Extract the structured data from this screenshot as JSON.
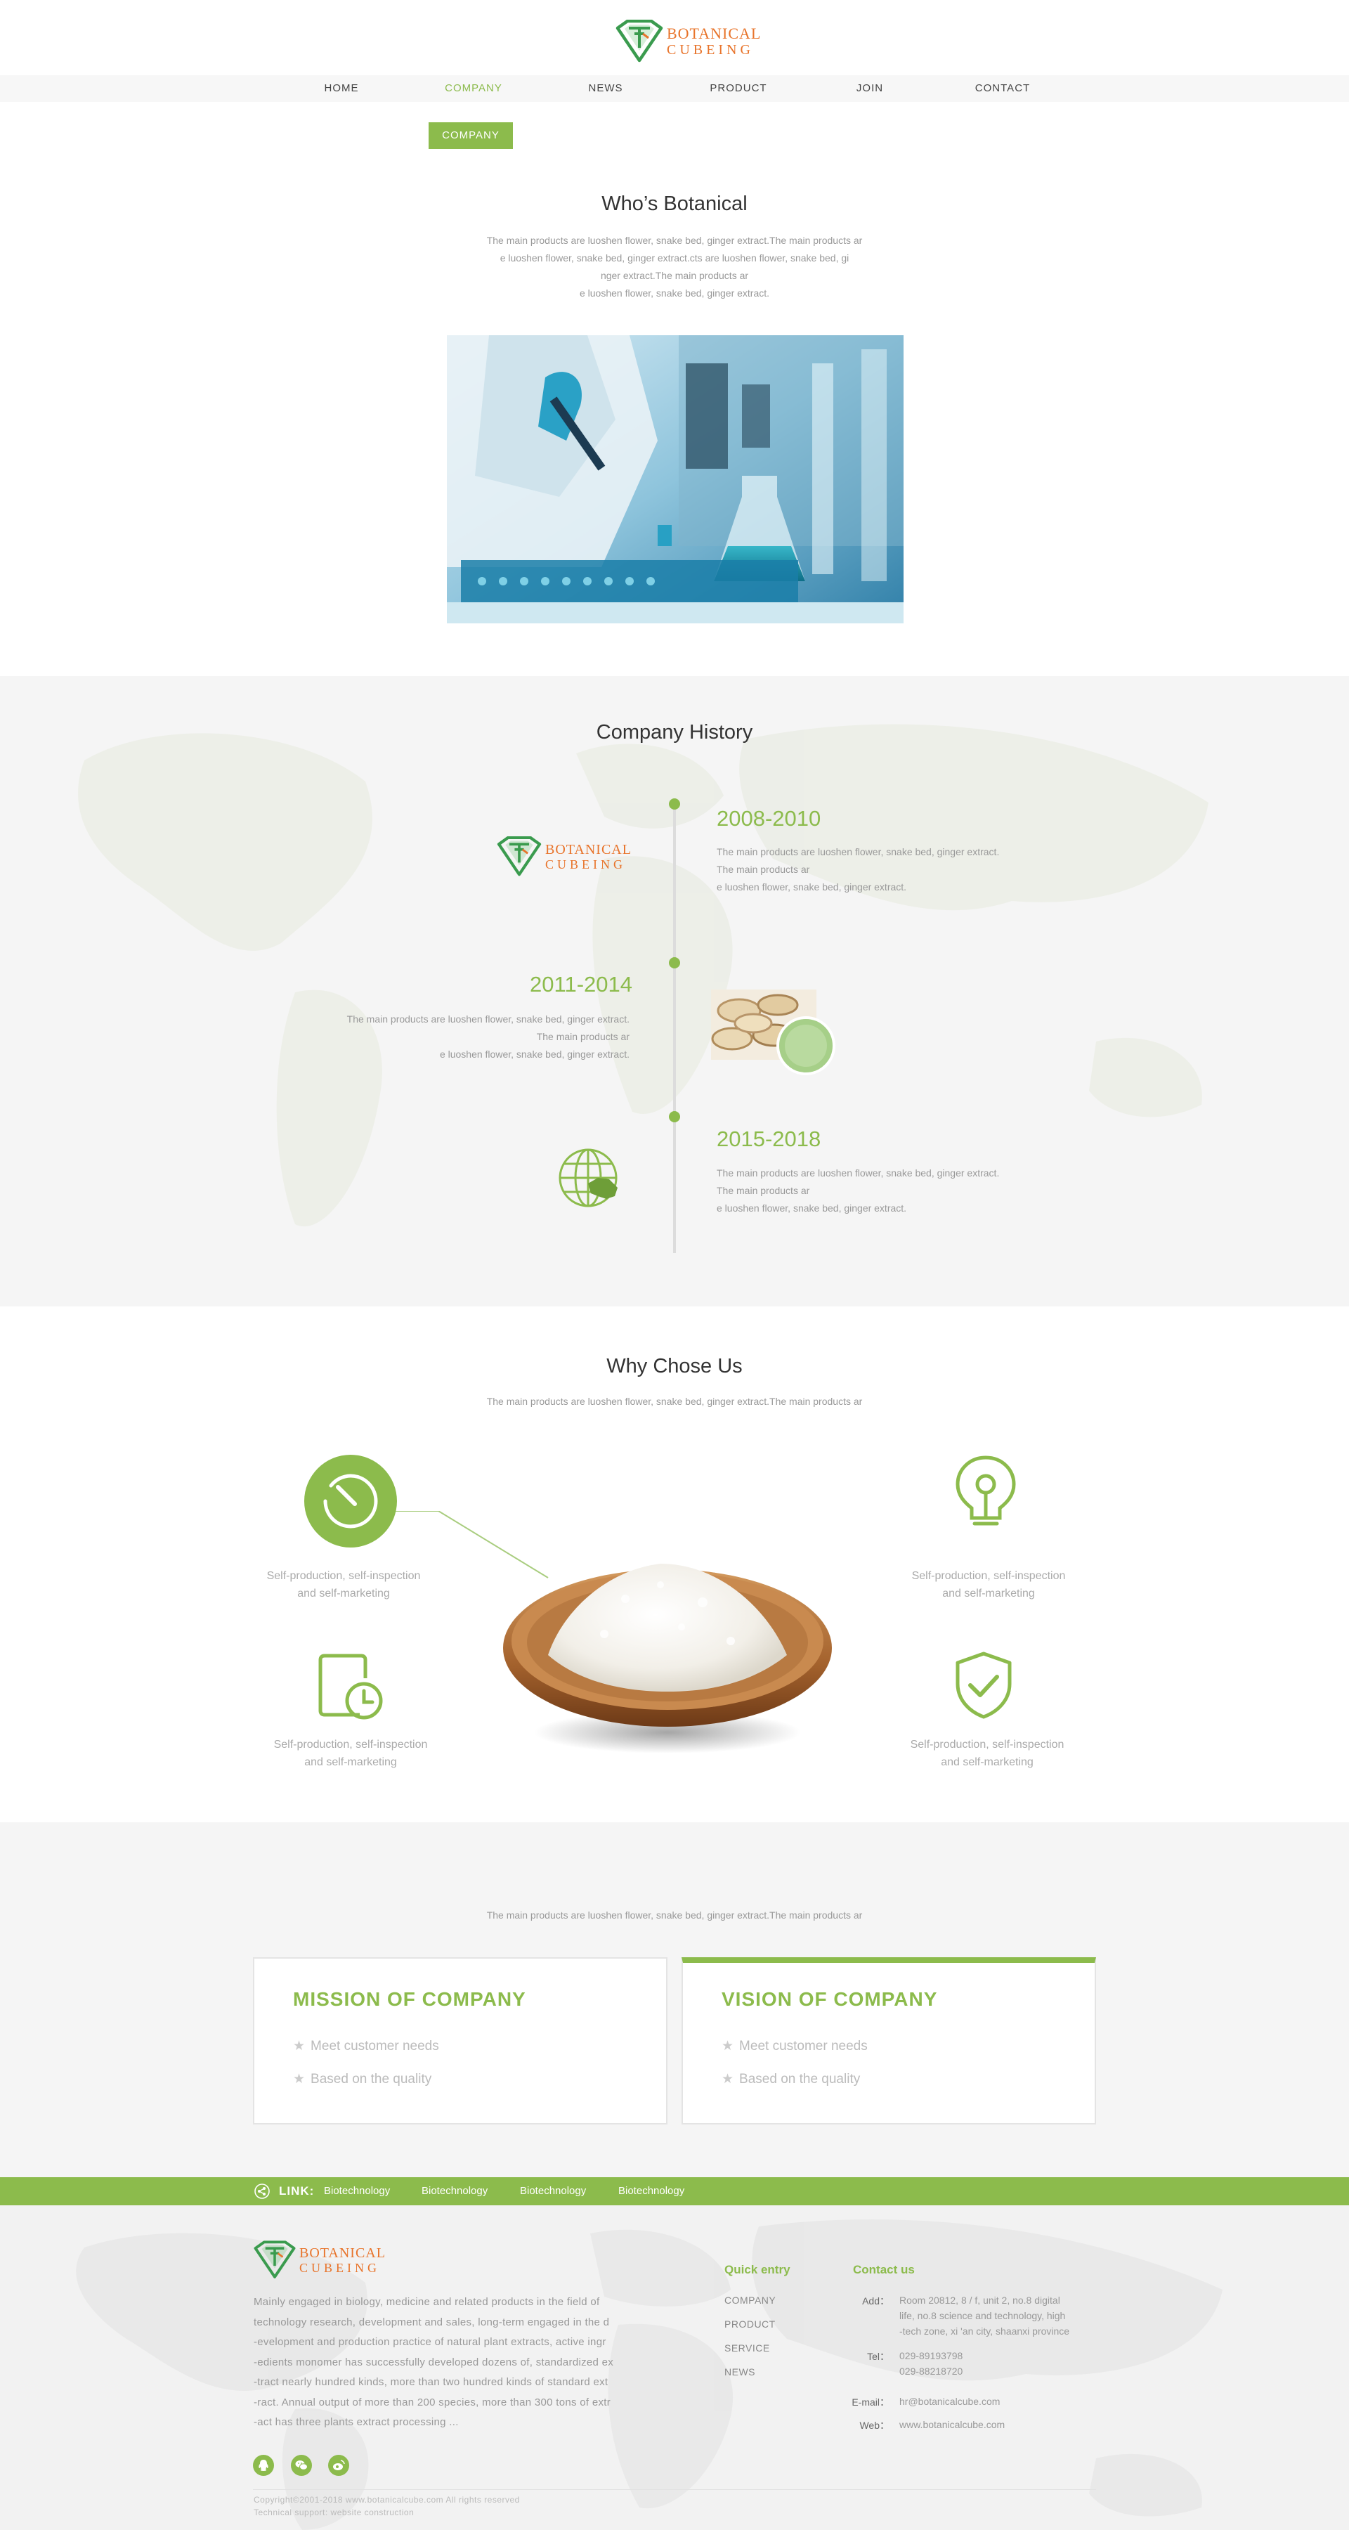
{
  "brand": {
    "line1": "BOTANICAL",
    "line2": "CUBEING"
  },
  "nav": [
    "HOME",
    "COMPANY",
    "NEWS",
    "PRODUCT",
    "JOIN",
    "CONTACT"
  ],
  "nav_active": "COMPANY",
  "breadcrumb": "COMPANY",
  "who": {
    "title": "Who’s Botanical",
    "lines": [
      "The main products are luoshen flower, snake bed, ginger extract.The main products ar",
      "e luoshen flower, snake bed, ginger extract.cts are luoshen flower, snake bed, gi",
      "nger extract.The main products ar",
      "e luoshen flower, snake bed, ginger extract."
    ]
  },
  "history": {
    "title": "Company History",
    "items": [
      {
        "year": "2008-2010",
        "lines": [
          "The main products are luoshen flower, snake bed, ginger extract.",
          "The main products ar",
          "e luoshen flower, snake bed, ginger extract."
        ]
      },
      {
        "year": "2011-2014",
        "lines": [
          "The main products are luoshen flower, snake bed, ginger extract.",
          "The main products ar",
          "e luoshen flower, snake bed, ginger extract."
        ]
      },
      {
        "year": "2015-2018",
        "lines": [
          "The main products are luoshen flower, snake bed, ginger extract.",
          "The main products ar",
          "e luoshen flower, snake bed, ginger extract."
        ]
      }
    ]
  },
  "why": {
    "title": "Why Chose Us",
    "subtitle": "The main products are luoshen flower, snake bed, ginger extract.The main products ar",
    "items": [
      {
        "icon": "dial-icon",
        "line1": "Self-production, self-inspection",
        "line2": "and self-marketing"
      },
      {
        "icon": "lightbulb-icon",
        "line1": "Self-production, self-inspection",
        "line2": "and self-marketing"
      },
      {
        "icon": "document-clock-icon",
        "line1": "Self-production, self-inspection",
        "line2": "and self-marketing"
      },
      {
        "icon": "shield-check-icon",
        "line1": "Self-production, self-inspection",
        "line2": "and self-marketing"
      }
    ]
  },
  "mission": {
    "subtitle": "The main products are luoshen flower, snake bed, ginger extract.The main products ar",
    "cards": [
      {
        "title": "MISSION OF COMPANY",
        "points": [
          "Meet customer needs",
          "Based on the quality"
        ]
      },
      {
        "title": "VISION OF COMPANY",
        "points": [
          "Meet customer needs",
          "Based on the quality"
        ]
      }
    ]
  },
  "links": {
    "label": "LINK:",
    "items": [
      "Biotechnology",
      "Biotechnology",
      "Biotechnology",
      "Biotechnology"
    ]
  },
  "footer": {
    "about": [
      "Mainly engaged in biology, medicine and related products in the field of",
      "technology research, development and sales, long-term engaged in the d",
      "-evelopment and production practice of natural plant extracts, active ingr",
      "-edients monomer has successfully developed dozens of, standardized ex",
      "-tract nearly hundred kinds, more than two hundred kinds of standard ext",
      "-ract. Annual output of more than 200 species, more than 300 tons of extr",
      "-act has three plants extract processing  ..."
    ],
    "quick_title": "Quick entry",
    "quick": [
      "COMPANY",
      "PRODUCT",
      "SERVICE",
      "NEWS"
    ],
    "contact_title": "Contact us",
    "contact": {
      "add_label": "Add：",
      "add": [
        "Room 20812, 8 / f, unit 2, no.8 digital",
        "life, no.8 science and technology, high",
        "-tech zone, xi 'an city, shaanxi province"
      ],
      "tel_label": "Tel：",
      "tel": [
        "029-89193798",
        "029-88218720"
      ],
      "email_label": "E-mail：",
      "email": "hr@botanicalcube.com",
      "web_label": "Web：",
      "web": "www.botanicalcube.com"
    },
    "copyright": "Copyright©2001-2018 www.botanicalcube.com All rights reserved",
    "support": "Technical support: website construction"
  },
  "colors": {
    "accent": "#8cbb4c",
    "brand_orange": "#e8742b",
    "logo_green": "#3a9b4e"
  }
}
